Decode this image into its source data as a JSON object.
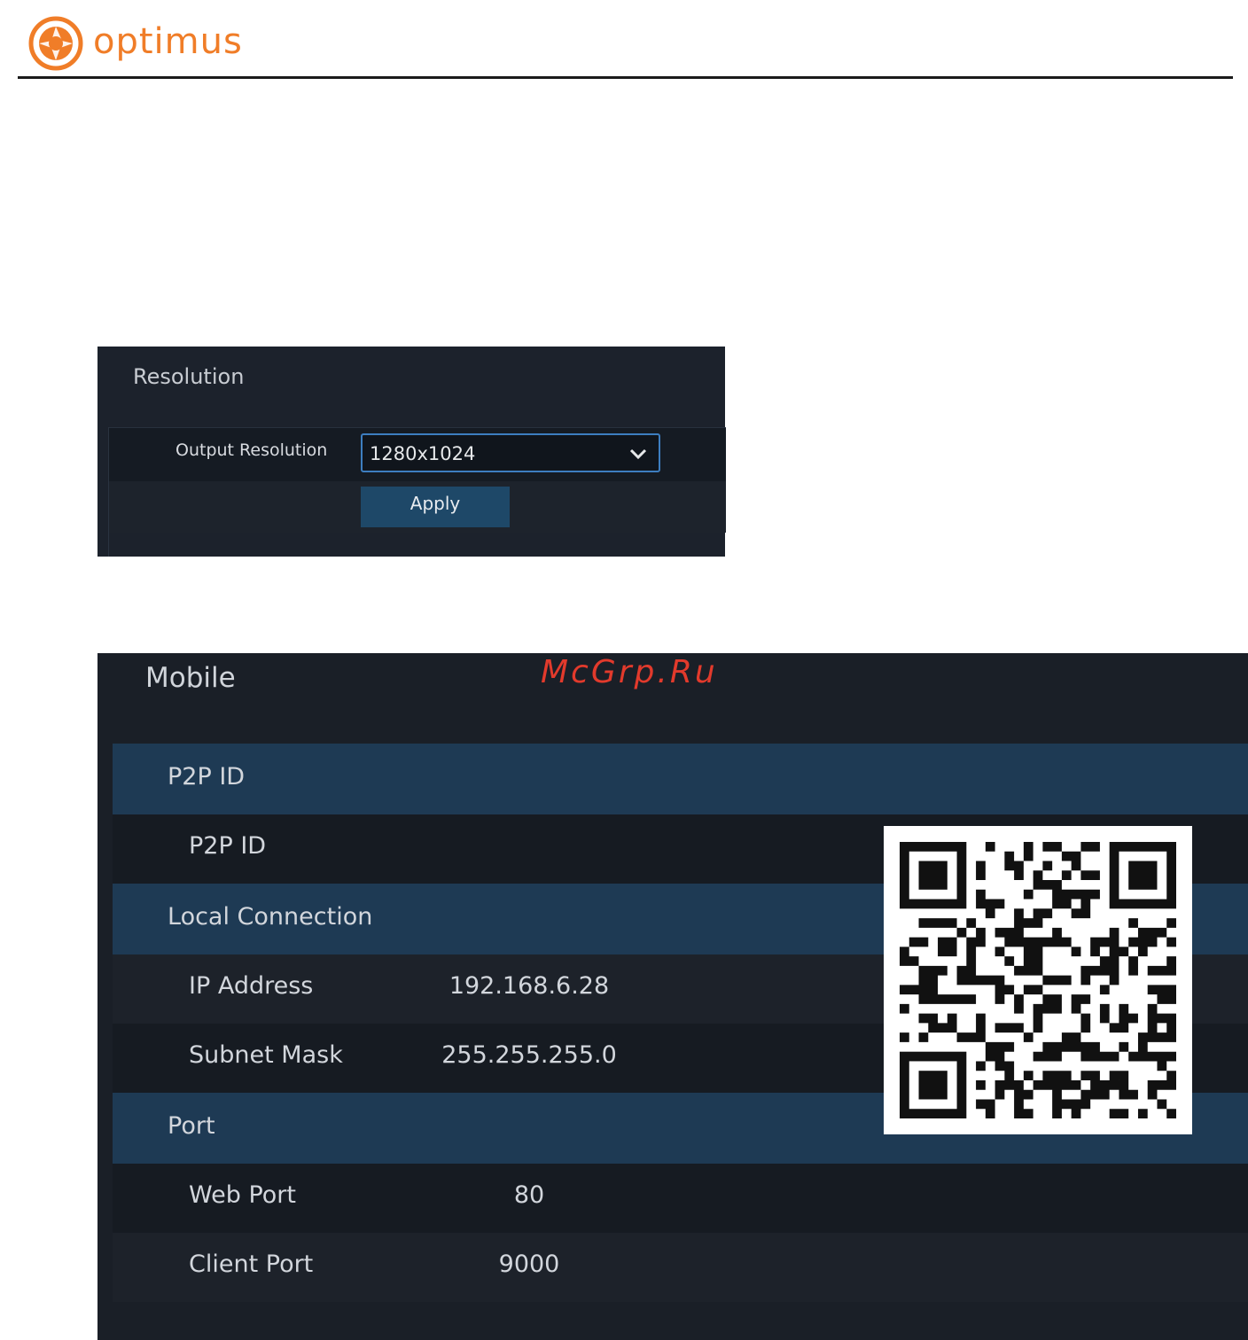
{
  "header": {
    "brand": "optimus",
    "brand_color": "#f07d28"
  },
  "resolution": {
    "title": "Resolution",
    "output_label": "Output Resolution",
    "output_value": "1280x1024",
    "apply_label": "Apply",
    "accent": "#3d7ec0"
  },
  "mobile": {
    "title": "Mobile",
    "sections": {
      "p2p": {
        "heading": "P2P ID",
        "row_label": "P2P ID"
      },
      "local": {
        "heading": "Local Connection",
        "ip_label": "IP Address",
        "ip_value": "192.168.6.28",
        "mask_label": "Subnet Mask",
        "mask_value": "255.255.255.0"
      },
      "port": {
        "heading": "Port",
        "web_label": "Web Port",
        "web_value": "80",
        "client_label": "Client Port",
        "client_value": "9000"
      }
    },
    "qr_icon": "qr-code-icon"
  },
  "watermark": "McGrp.Ru"
}
